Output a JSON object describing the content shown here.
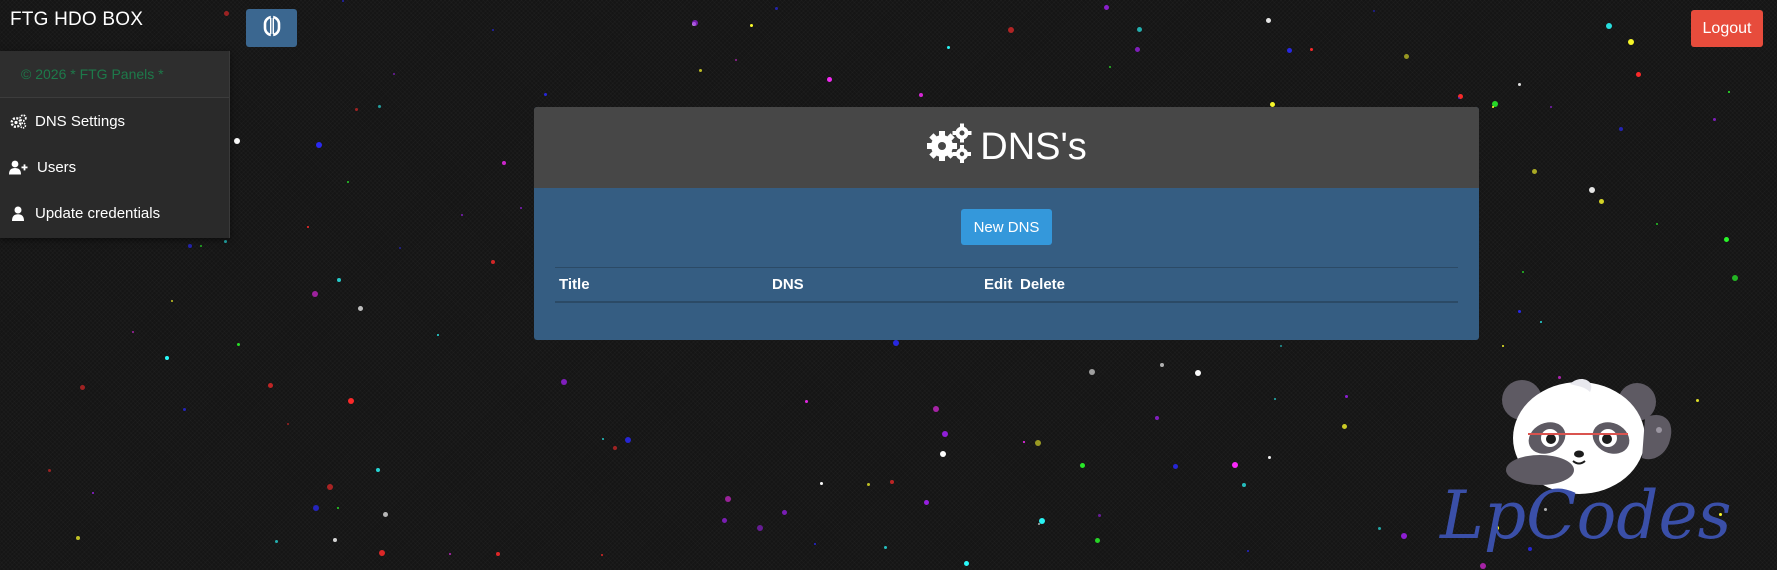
{
  "header": {
    "brand": "FTG HDO BOX",
    "toggle_icon": "sidebar-toggle-icon",
    "logout_label": "Logout"
  },
  "sidebar": {
    "copyright": "© 2026 * FTG Panels *",
    "items": [
      {
        "label": "DNS Settings",
        "icon": "gears-icon"
      },
      {
        "label": "Users",
        "icon": "user-plus-icon"
      },
      {
        "label": "Update credentials",
        "icon": "user-icon"
      }
    ]
  },
  "main": {
    "title": "DNS's",
    "title_icon": "gears-icon",
    "new_button_label": "New DNS",
    "table": {
      "columns": [
        "Title",
        "DNS",
        "Edit",
        "Delete"
      ],
      "rows": []
    }
  },
  "watermark": {
    "text": "LpCodes",
    "icon": "panda-mascot"
  },
  "colors": {
    "background": "#151515",
    "accent_blue": "#3498db",
    "card_body": "#355d82",
    "card_header": "#474747",
    "logout_red": "#e74c3c",
    "copyright_green": "#1d7a4a"
  }
}
